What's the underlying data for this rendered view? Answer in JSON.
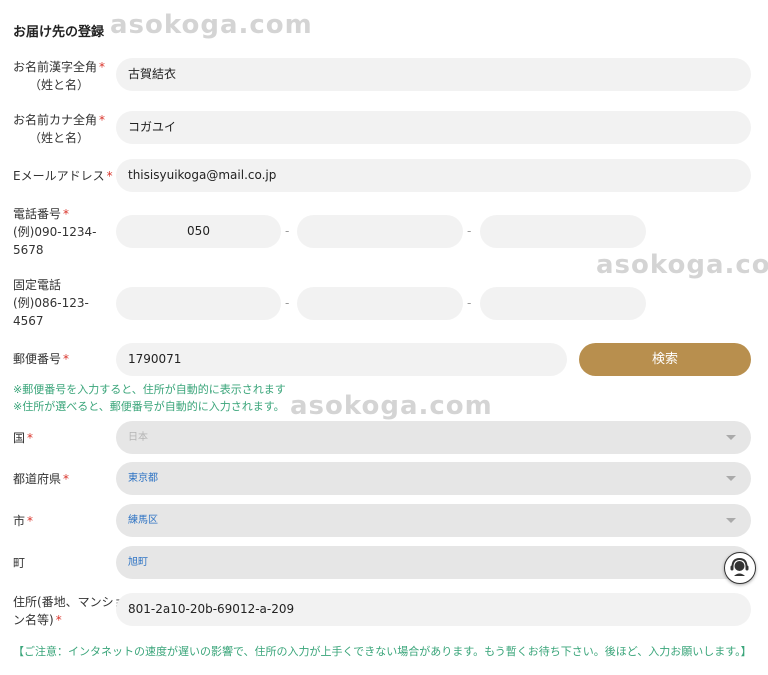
{
  "form": {
    "title": "お届け先の登録",
    "watermark": "asokoga.com",
    "required_mark": "*",
    "name_kanji": {
      "label": "お名前漢字全角",
      "sub": "（姓と名）",
      "value": "古賀結衣"
    },
    "name_kana": {
      "label": "お名前カナ全角",
      "sub": "（姓と名）",
      "value": "コガユイ"
    },
    "email": {
      "label": "Eメールアドレス",
      "value": "thisisyuikoga@mail.co.jp"
    },
    "mobile": {
      "label": "電話番号",
      "example_1": "(例)090-1234-",
      "example_2": "5678",
      "part1": "050",
      "part2": "",
      "part3": "",
      "separator": "-"
    },
    "landline": {
      "label": "固定電話",
      "example_1": "(例)086-123-",
      "example_2": "4567",
      "part1": "",
      "part2": "",
      "part3": ""
    },
    "postal": {
      "label": "郵便番号",
      "value": "1790071",
      "search_button": "検索"
    },
    "notes": [
      "※郵便番号を入力すると、住所が自動的に表示されます",
      "※住所が選べると、郵便番号が自動的に入力されます。"
    ],
    "country": {
      "label": "国",
      "value": "日本"
    },
    "prefecture": {
      "label": "都道府県",
      "value": "東京都"
    },
    "city": {
      "label": "市",
      "value": "練馬区"
    },
    "town": {
      "label": "町",
      "value": "旭町"
    },
    "address": {
      "label_1": "住所(番地、マンショ",
      "label_2": "ン名等)",
      "value": "801-2a10-20b-69012-a-209"
    },
    "footnote": "【ご注意：インタネットの速度が遅いの影響で、住所の入力が上手くできない場合があります。もう暫くお待ち下さい。後ほど、入力お願いします。】"
  },
  "colors": {
    "accent": "#b88f4e",
    "note_green": "#3aa57a",
    "required_red": "#d9342b",
    "link_blue": "#2d73c4"
  },
  "icons": {
    "chat": "support-chat-icon",
    "caret": "chevron-down-icon"
  }
}
